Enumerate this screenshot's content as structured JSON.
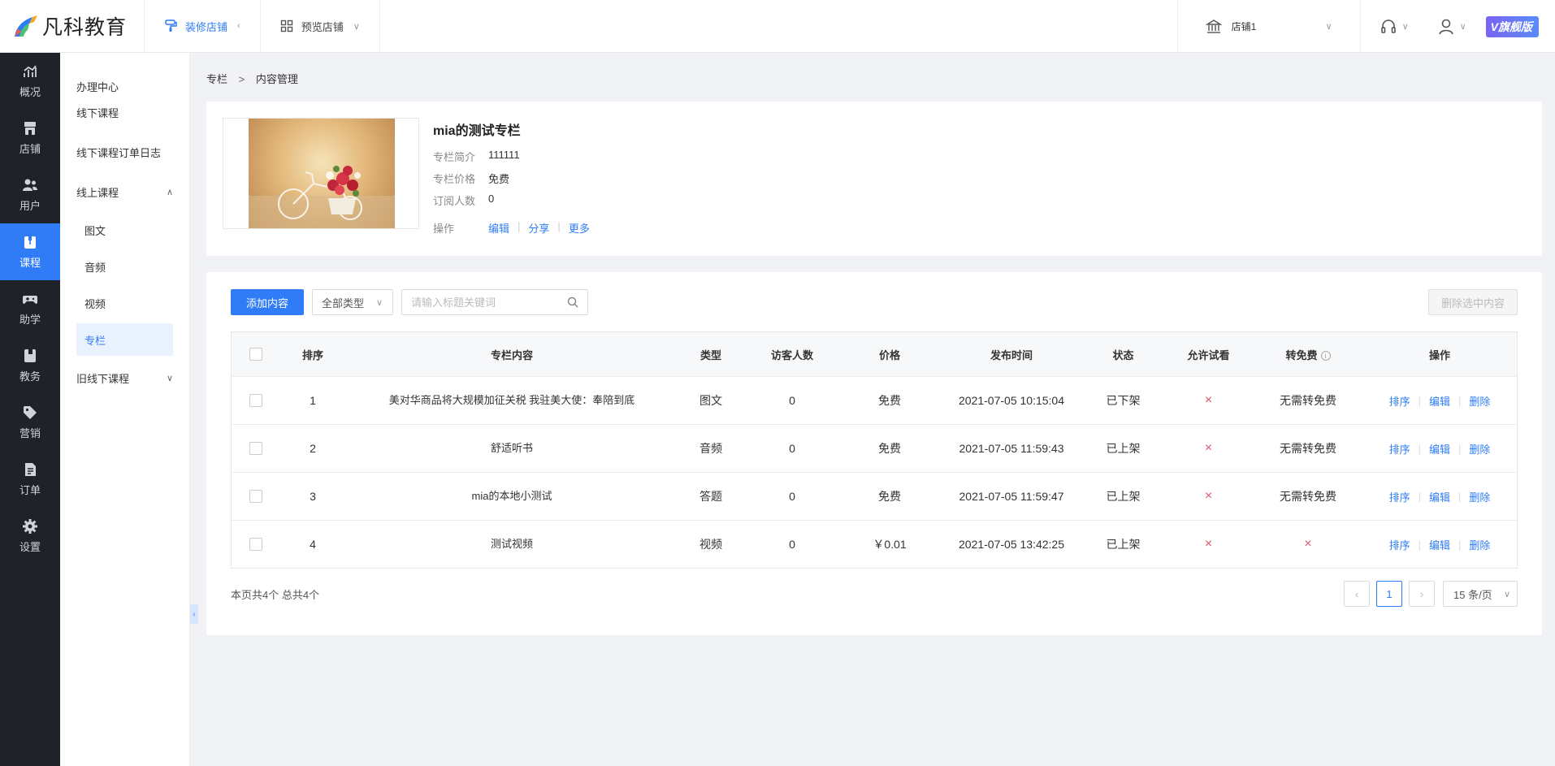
{
  "brand": {
    "name": "凡科教育",
    "edition": "旗舰版"
  },
  "topbar": {
    "tabs": [
      {
        "label": "装修店铺",
        "icon": "paint-roller-icon"
      },
      {
        "label": "预览店铺",
        "icon": "grid-icon"
      }
    ],
    "store": "店铺1"
  },
  "leftnav": [
    {
      "label": "概况",
      "icon": "chart-icon"
    },
    {
      "label": "店铺",
      "icon": "store-icon"
    },
    {
      "label": "用户",
      "icon": "users-icon"
    },
    {
      "label": "课程",
      "icon": "course-icon"
    },
    {
      "label": "助学",
      "icon": "gamepad-icon"
    },
    {
      "label": "教务",
      "icon": "book-icon"
    },
    {
      "label": "营销",
      "icon": "tag-icon"
    },
    {
      "label": "订单",
      "icon": "order-icon"
    },
    {
      "label": "设置",
      "icon": "gear-icon"
    }
  ],
  "subnav": {
    "items": [
      "办理中心",
      "线下课程",
      "线下课程订单日志"
    ],
    "group": "线上课程",
    "children": [
      "图文",
      "音频",
      "视频",
      "专栏"
    ],
    "legacy": "旧线下课程"
  },
  "breadcrumb": [
    "专栏",
    "内容管理"
  ],
  "column": {
    "title": "mia的测试专栏",
    "intro_label": "专栏简介",
    "intro": "111111",
    "price_label": "专栏价格",
    "price": "免费",
    "subs_label": "订阅人数",
    "subs": "0",
    "ops_label": "操作",
    "ops": [
      "编辑",
      "分享",
      "更多"
    ]
  },
  "toolbar": {
    "add": "添加内容",
    "type_filter": "全部类型",
    "search_placeholder": "请输入标题关键词",
    "delete_selected": "删除选中内容"
  },
  "table": {
    "headers": [
      "排序",
      "专栏内容",
      "类型",
      "访客人数",
      "价格",
      "发布时间",
      "状态",
      "允许试看",
      "转免费",
      "操作"
    ],
    "rows": [
      {
        "idx": "1",
        "content": "美对华商品将大规模加征关税 我驻美大使：奉陪到底",
        "type": "图文",
        "visitors": "0",
        "price": "免费",
        "date": "2021-07-05 10:15:04",
        "status": "已下架",
        "trial": "×",
        "free": "无需转免费"
      },
      {
        "idx": "2",
        "content": "舒适听书",
        "type": "音频",
        "visitors": "0",
        "price": "免费",
        "date": "2021-07-05 11:59:43",
        "status": "已上架",
        "trial": "×",
        "free": "无需转免费"
      },
      {
        "idx": "3",
        "content": "mia的本地小测试",
        "type": "答题",
        "visitors": "0",
        "price": "免费",
        "date": "2021-07-05 11:59:47",
        "status": "已上架",
        "trial": "×",
        "free": "无需转免费"
      },
      {
        "idx": "4",
        "content": "测试视频",
        "type": "视频",
        "visitors": "0",
        "price": "￥0.01",
        "date": "2021-07-05 13:42:25",
        "status": "已上架",
        "trial": "×",
        "free": "×"
      }
    ],
    "row_ops": [
      "排序",
      "编辑",
      "删除"
    ]
  },
  "footer": {
    "count": "本页共4个 总共4个",
    "page": "1",
    "page_size": "15 条/页"
  },
  "colors": {
    "accent": "#2f7cf6",
    "nav_bg": "#1f2329",
    "cross": "#e0566a"
  }
}
